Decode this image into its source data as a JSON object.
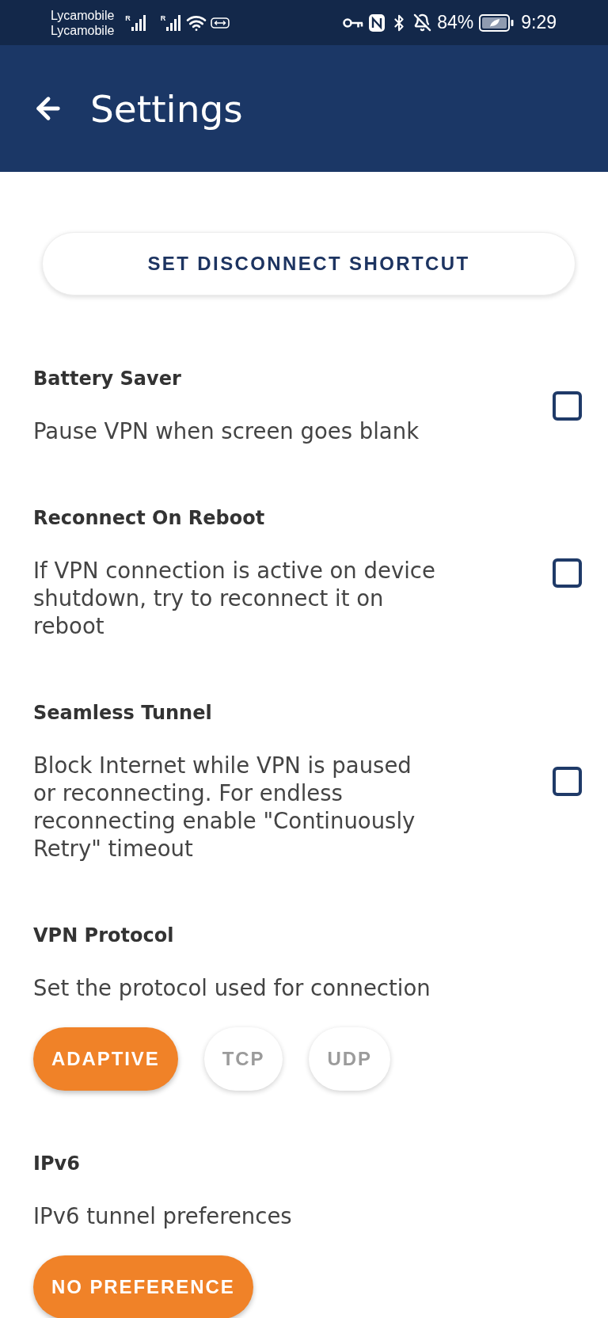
{
  "status_bar": {
    "carriers": [
      "Lycamobile",
      "Lycamobile"
    ],
    "signals": [
      {
        "roaming": "R"
      },
      {
        "roaming": "R"
      }
    ],
    "battery_percent": "84%",
    "time": "9:29"
  },
  "app_bar": {
    "title": "Settings"
  },
  "shortcut_button": {
    "label": "SET DISCONNECT SHORTCUT"
  },
  "settings": [
    {
      "kind": "checkbox",
      "title": "Battery Saver",
      "description": "Pause VPN when screen goes blank",
      "checked": false
    },
    {
      "kind": "checkbox",
      "title": "Reconnect On Reboot",
      "description": "If VPN connection is active on device shutdown, try to reconnect it on reboot",
      "checked": false
    },
    {
      "kind": "checkbox",
      "title": "Seamless Tunnel",
      "description": "Block Internet while VPN is paused or reconnecting. For endless reconnecting enable \"Continuously Retry\" timeout",
      "checked": false
    },
    {
      "kind": "choice",
      "title": "VPN Protocol",
      "description": "Set the protocol used for connection",
      "options": [
        {
          "label": "ADAPTIVE",
          "selected": true
        },
        {
          "label": "TCP",
          "selected": false
        },
        {
          "label": "UDP",
          "selected": false
        }
      ]
    },
    {
      "kind": "choice",
      "title": "IPv6",
      "description": "IPv6 tunnel preferences",
      "options": [
        {
          "label": "NO PREFERENCE",
          "selected": true
        }
      ]
    }
  ]
}
